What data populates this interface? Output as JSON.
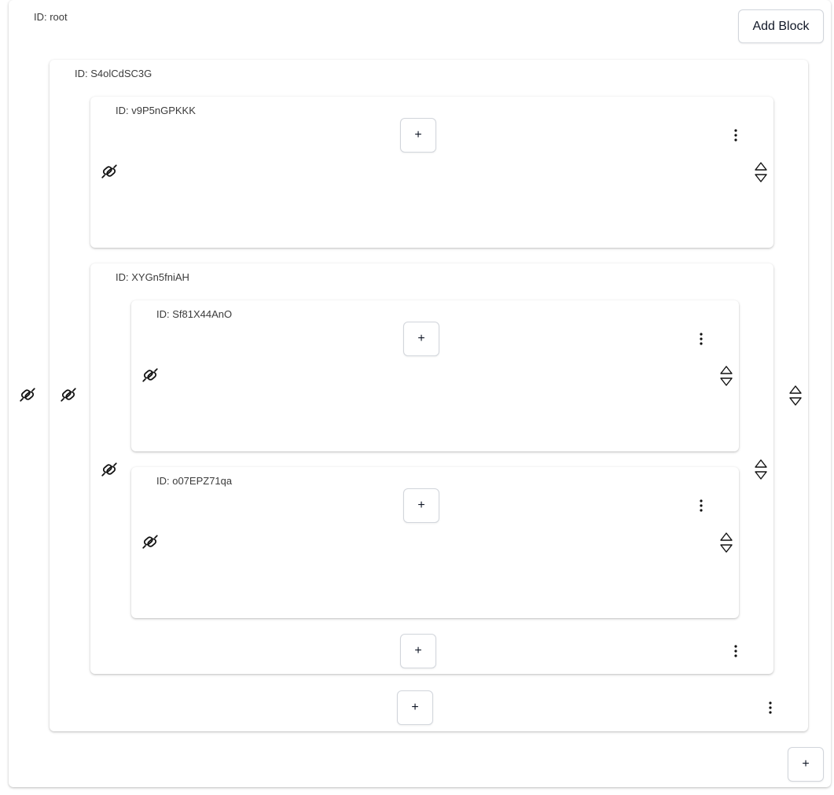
{
  "root": {
    "id_label": "ID: root",
    "add_block_label": "Add Block",
    "add_label": "+",
    "drag_icon": "link-drag-icon",
    "blocks": [
      {
        "id_label": "ID: S4olCdSC3G",
        "add_label": "+",
        "menu_icon": "more-vertical-icon",
        "drag_icon": "link-drag-icon",
        "move_icon": "move-up-down-icon",
        "children": [
          {
            "id_label": "ID: v9P5nGPKKK",
            "add_label": "+",
            "menu_icon": "more-vertical-icon",
            "drag_icon": "link-drag-icon",
            "move_icon": "move-up-down-icon"
          },
          {
            "id_label": "ID: XYGn5fniAH",
            "add_label": "+",
            "menu_icon": "more-vertical-icon",
            "drag_icon": "link-drag-icon",
            "move_icon": "move-up-down-icon",
            "children": [
              {
                "id_label": "ID: Sf81X44AnO",
                "add_label": "+",
                "menu_icon": "more-vertical-icon",
                "drag_icon": "link-drag-icon",
                "move_icon": "move-up-down-icon"
              },
              {
                "id_label": "ID: o07EPZ71qa",
                "add_label": "+",
                "menu_icon": "more-vertical-icon",
                "drag_icon": "link-drag-icon",
                "move_icon": "move-up-down-icon"
              }
            ]
          }
        ]
      }
    ]
  }
}
